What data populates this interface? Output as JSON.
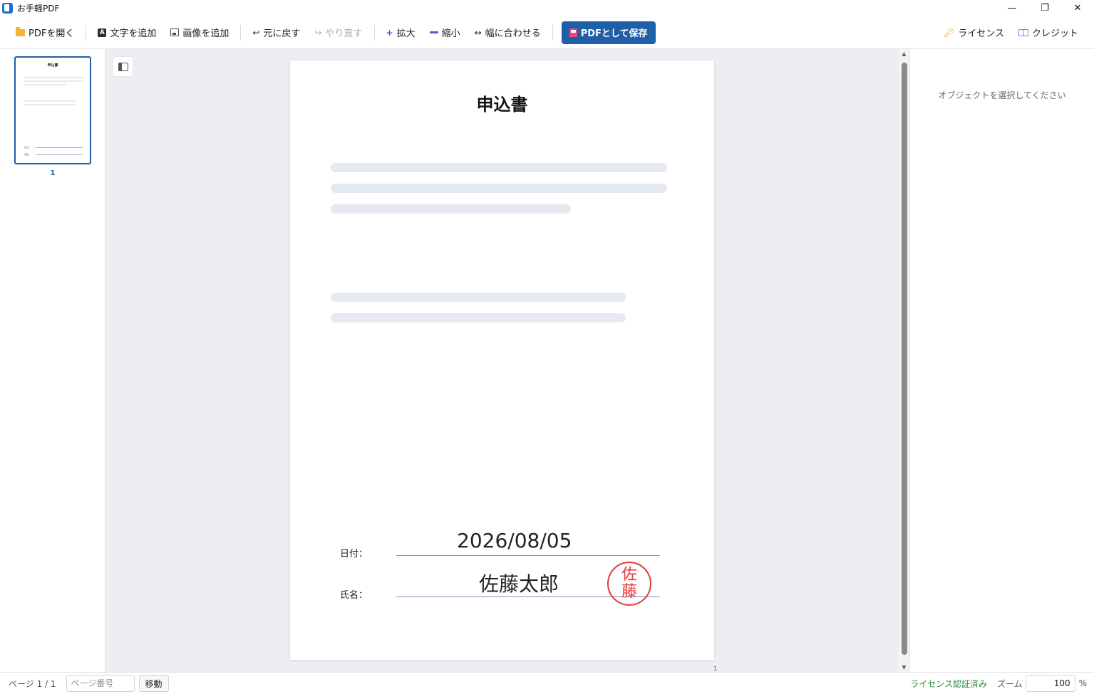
{
  "app": {
    "title": "お手軽PDF"
  },
  "window_controls": {
    "minimize": "—",
    "maximize": "❐",
    "close": "✕"
  },
  "toolbar": {
    "open": "PDFを開く",
    "add_text": "文字を追加",
    "add_image": "画像を追加",
    "undo": "元に戻す",
    "redo": "やり直す",
    "zoom_in": "拡大",
    "zoom_out": "縮小",
    "fit_width": "幅に合わせる",
    "save": "PDFとして保存",
    "license": "ライセンス",
    "credits": "クレジット",
    "icons": {
      "open": "folder-icon",
      "add_text": "text-icon",
      "add_image": "image-icon",
      "undo": "undo-icon",
      "redo": "redo-icon",
      "zoom_in": "plus-icon",
      "zoom_out": "minus-icon",
      "fit_width": "fit-width-icon",
      "save": "save-icon",
      "license": "key-icon",
      "credits": "book-icon"
    }
  },
  "thumbnails": [
    {
      "page_label": "1",
      "selected": true
    }
  ],
  "document": {
    "title": "申込書",
    "date_label": "日付：",
    "date_value": "2026/08/05",
    "name_label": "氏名：",
    "name_value": "佐藤太郎",
    "seal_chars": [
      "佐",
      "藤"
    ],
    "page_number": "1"
  },
  "right_panel": {
    "hint": "オブジェクトを選択してください"
  },
  "statusbar": {
    "page_info": "ページ 1 / 1",
    "page_input_placeholder": "ページ番号",
    "go_button": "移動",
    "license_status": "ライセンス認証済み",
    "zoom_label": "ズーム",
    "zoom_value": "100",
    "zoom_unit": "%"
  },
  "colors": {
    "accent": "#1f5fa8",
    "seal": "#e23b3b",
    "license_ok": "#2e8a3a",
    "canvas_bg": "#eceef1"
  }
}
